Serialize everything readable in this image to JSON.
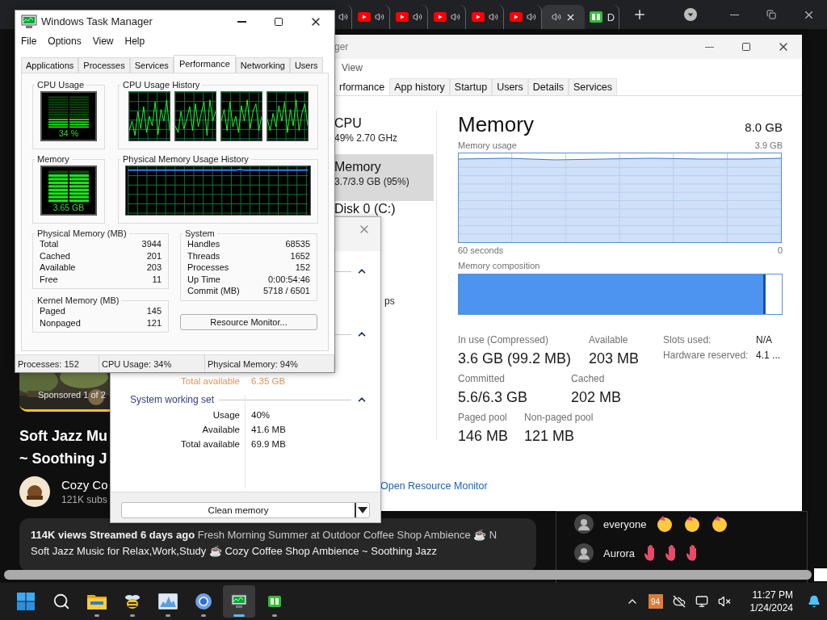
{
  "browser": {
    "tabs": [
      {
        "kind": "audio",
        "selected": false
      },
      {
        "kind": "video",
        "selected": false
      },
      {
        "kind": "video",
        "selected": false
      },
      {
        "kind": "video",
        "selected": false
      },
      {
        "kind": "video",
        "selected": false
      },
      {
        "kind": "video",
        "selected": false
      },
      {
        "kind": "audio",
        "selected": true
      },
      {
        "kind": "app",
        "label": "D",
        "selected": false
      }
    ]
  },
  "video": {
    "sponsored": "Sponsored 1 of 2",
    "title_lines": [
      "Soft Jazz Mu",
      "~ Soothing J"
    ],
    "channel": "Cozy Co",
    "subscribers": "121K subs",
    "views": "114K views",
    "streamed": "Streamed 6 days ago",
    "description_lines": [
      "Fresh Morning Summer at Outdoor Coffee Shop Ambience ☕ N",
      "Soft Jazz Music for Relax,Work,Study ☕ Cozy Coffee Shop Ambience ~ Soothing Jazz"
    ]
  },
  "chat": [
    {
      "text": "everyone"
    },
    {
      "text": "Aurora"
    }
  ],
  "task_manager": {
    "title": "ger",
    "menu": [
      "View"
    ],
    "tabs": [
      {
        "label": "rformance",
        "selected": true
      },
      {
        "label": "App history",
        "selected": false
      },
      {
        "label": "Startup",
        "selected": false
      },
      {
        "label": "Users",
        "selected": false
      },
      {
        "label": "Details",
        "selected": false
      },
      {
        "label": "Services",
        "selected": false
      }
    ],
    "sidebar": [
      {
        "name": "CPU",
        "detail": "49%  2.70 GHz",
        "selected": false
      },
      {
        "name": "Memory",
        "detail": "3.7/3.9 GB (95%)",
        "selected": true
      },
      {
        "name": "Disk 0 (C:)",
        "selected": false
      }
    ],
    "sidebar_fragment": "ps",
    "heading": "Memory",
    "capacity": "8.0 GB",
    "usage_label": "Memory usage",
    "usage_max": "3.9 GB",
    "axis_start": "60 seconds",
    "axis_end": "0",
    "composition_label": "Memory composition",
    "composition": {
      "level": 0.95
    },
    "stat_rows": [
      [
        {
          "label": "In use (Compressed)",
          "value": "3.6 GB (99.2 MB)"
        },
        {
          "label": "Available",
          "value": "203 MB"
        }
      ],
      [
        {
          "label": "Committed",
          "value": "5.6/6.3 GB"
        },
        {
          "label": "Cached",
          "value": "202 MB"
        }
      ],
      [
        {
          "label": "Paged pool",
          "value": "146 MB"
        },
        {
          "label": "Non-paged pool",
          "value": "121 MB"
        }
      ]
    ],
    "hardware": [
      {
        "label": "Slots used:",
        "value": "N/A"
      },
      {
        "label": "Hardware reserved:",
        "value": "4.1 ..."
      }
    ],
    "link": "Open Resource Monitor"
  },
  "cleaner": {
    "sections": [
      {
        "expanded": true
      },
      {
        "expanded": true
      }
    ],
    "total_available": {
      "label": "Total available",
      "value": "6.35 GB"
    },
    "working_set": {
      "title": "System working set",
      "expanded": true,
      "rows": [
        {
          "label": "Usage",
          "value": "40%"
        },
        {
          "label": "Available",
          "value": "41.6 MB"
        },
        {
          "label": "Total available",
          "value": "69.9 MB"
        }
      ]
    },
    "button": "Clean memory"
  },
  "old_task_manager": {
    "title": "Windows Task Manager",
    "menu": [
      "File",
      "Options",
      "View",
      "Help"
    ],
    "tabs": [
      {
        "label": "Applications",
        "selected": false
      },
      {
        "label": "Processes",
        "selected": false
      },
      {
        "label": "Services",
        "selected": false
      },
      {
        "label": "Performance",
        "selected": true
      },
      {
        "label": "Networking",
        "selected": false
      },
      {
        "label": "Users",
        "selected": false
      }
    ],
    "cpu_usage": {
      "title": "CPU Usage",
      "reading": "34 %",
      "level": 0.34
    },
    "cpu_history": {
      "title": "CPU Usage History"
    },
    "memory": {
      "title": "Memory",
      "reading": "3.65 GB",
      "level": 0.94
    },
    "memory_history": {
      "title": "Physical Memory Usage History"
    },
    "physical_memory": {
      "title": "Physical Memory (MB)",
      "rows": [
        {
          "label": "Total",
          "value": "3944"
        },
        {
          "label": "Cached",
          "value": "201"
        },
        {
          "label": "Available",
          "value": "203"
        },
        {
          "label": "Free",
          "value": "11"
        }
      ]
    },
    "kernel_memory": {
      "title": "Kernel Memory (MB)",
      "rows": [
        {
          "label": "Paged",
          "value": "145"
        },
        {
          "label": "Nonpaged",
          "value": "121"
        }
      ]
    },
    "system": {
      "title": "System",
      "rows": [
        {
          "label": "Handles",
          "value": "68535"
        },
        {
          "label": "Threads",
          "value": "1652"
        },
        {
          "label": "Processes",
          "value": "152"
        },
        {
          "label": "Up Time",
          "value": "0:00:54:46"
        },
        {
          "label": "Commit (MB)",
          "value": "5718 / 6501"
        }
      ]
    },
    "button": "Resource Monitor...",
    "status": [
      "Processes: 152",
      "CPU Usage: 34%",
      "Physical Memory: 94%"
    ]
  },
  "taskbar": {
    "apps": [
      {
        "kind": "start",
        "selected": false,
        "running": false
      },
      {
        "kind": "search",
        "selected": false,
        "running": false
      },
      {
        "kind": "folder",
        "selected": false,
        "running": true
      },
      {
        "kind": "bee",
        "selected": false,
        "running": true
      },
      {
        "kind": "chart",
        "selected": false,
        "running": true
      },
      {
        "kind": "browser",
        "selected": false,
        "running": true
      },
      {
        "kind": "taskmgr",
        "selected": true,
        "running": true
      },
      {
        "kind": "meter",
        "selected": false,
        "running": true
      }
    ],
    "badge": "94",
    "time": "11:27 PM",
    "date": "1/24/2024"
  }
}
